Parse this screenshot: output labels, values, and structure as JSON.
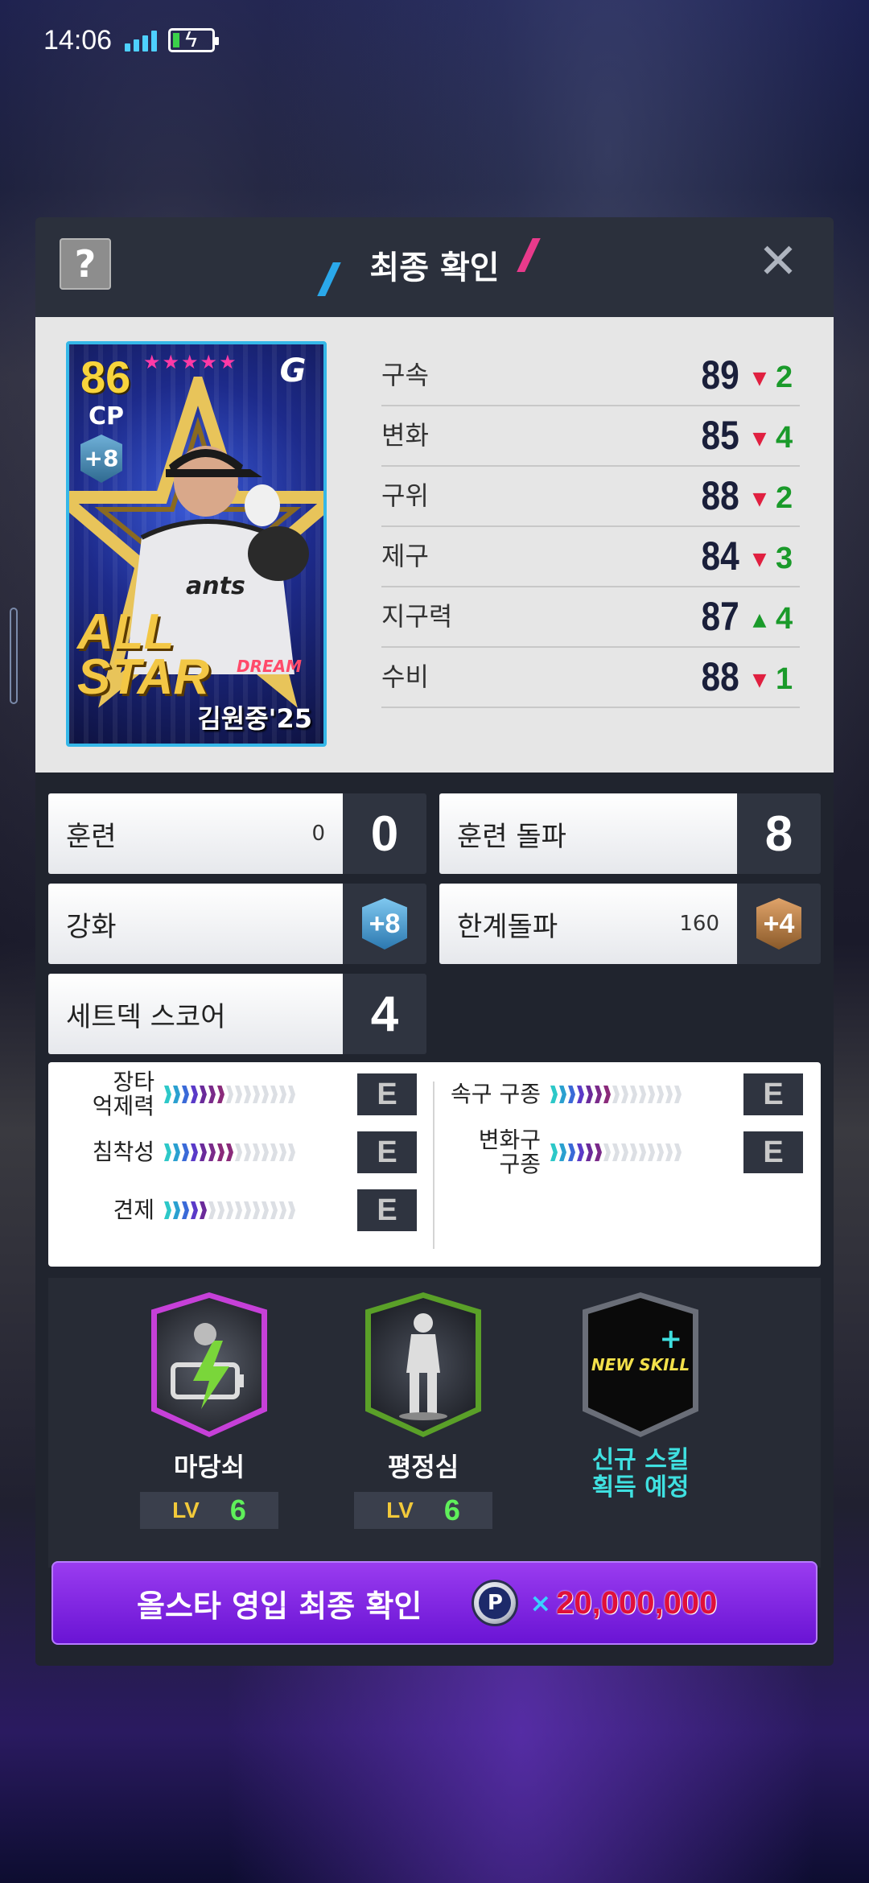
{
  "status_bar": {
    "time": "14:06"
  },
  "dialog": {
    "title": "최종 확인",
    "help_label": "?",
    "close_label": "✕"
  },
  "card": {
    "overall": "86",
    "position": "CP",
    "enhance": "+8",
    "stars": "★★★★★",
    "team_logo": "G",
    "series_text": "ALL STAR",
    "dream_text": "DREAM",
    "player_name": "김원중'25"
  },
  "stats": [
    {
      "label": "구속",
      "value": "89",
      "direction": "down",
      "delta": "2"
    },
    {
      "label": "변화",
      "value": "85",
      "direction": "down",
      "delta": "4"
    },
    {
      "label": "구위",
      "value": "88",
      "direction": "down",
      "delta": "2"
    },
    {
      "label": "제구",
      "value": "84",
      "direction": "down",
      "delta": "3"
    },
    {
      "label": "지구력",
      "value": "87",
      "direction": "up",
      "delta": "4"
    },
    {
      "label": "수비",
      "value": "88",
      "direction": "down",
      "delta": "1"
    }
  ],
  "info_boxes": {
    "training": {
      "label": "훈련",
      "sub": "0",
      "value": "0"
    },
    "training_break": {
      "label": "훈련 돌파",
      "value": "8"
    },
    "enhance": {
      "label": "강화",
      "badge": "+8"
    },
    "limit_break": {
      "label": "한계돌파",
      "sub": "160",
      "badge": "+4"
    },
    "setdeck": {
      "label": "세트덱 스코어",
      "value": "4"
    }
  },
  "ratings": [
    {
      "label": "장타\n억제력",
      "grade": "E",
      "fill": 0.45
    },
    {
      "label": "침착성",
      "grade": "E",
      "fill": 0.55
    },
    {
      "label": "견제",
      "grade": "E",
      "fill": 0.3
    },
    {
      "label": "속구 구종",
      "grade": "E",
      "fill": 0.45
    },
    {
      "label": "변화구\n구종",
      "grade": "E",
      "fill": 0.4
    }
  ],
  "skills": [
    {
      "name": "마당쇠",
      "lv_label": "LV",
      "level": "6"
    },
    {
      "name": "평정심",
      "lv_label": "LV",
      "level": "6"
    },
    {
      "badge": "NEW SKILL",
      "plus": "+",
      "name": "신규 스킬\n획득 예정"
    }
  ],
  "confirm": {
    "label": "올스타 영입 최종 확인",
    "currency_icon": "P",
    "times": "×",
    "cost": "20,000,000"
  },
  "colors": {
    "accent_purple": "#7a22e0",
    "stat_down": "#e02040",
    "stat_up": "#1a9a2a",
    "skill_cyan": "#3fe0e0"
  }
}
